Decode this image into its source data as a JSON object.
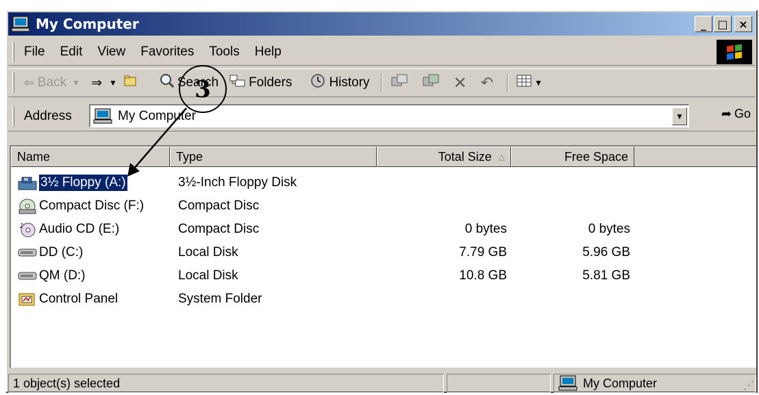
{
  "window": {
    "title": "My Computer",
    "controls": {
      "minimize": "_",
      "maximize": "□",
      "close": "×"
    }
  },
  "menubar": {
    "items": [
      "File",
      "Edit",
      "View",
      "Favorites",
      "Tools",
      "Help"
    ]
  },
  "toolbar": {
    "back": "Back",
    "search": "Search",
    "folders": "Folders",
    "history": "History"
  },
  "addressbar": {
    "label": "Address",
    "value": "My Computer",
    "go": "Go"
  },
  "listview": {
    "columns": [
      "Name",
      "Type",
      "Total Size",
      "Free Space"
    ],
    "rows": [
      {
        "name": "3½ Floppy (A:)",
        "type": "3½-Inch Floppy Disk",
        "total": "",
        "free": "",
        "icon": "floppy-drive-icon",
        "selected": true
      },
      {
        "name": "Compact Disc (F:)",
        "type": "Compact Disc",
        "total": "",
        "free": "",
        "icon": "cd-drive-icon"
      },
      {
        "name": "Audio CD (E:)",
        "type": "Compact Disc",
        "total": "0 bytes",
        "free": "0 bytes",
        "icon": "audio-cd-icon"
      },
      {
        "name": "DD (C:)",
        "type": "Local Disk",
        "total": "7.79 GB",
        "free": "5.96 GB",
        "icon": "hard-disk-icon"
      },
      {
        "name": "QM (D:)",
        "type": "Local Disk",
        "total": "10.8 GB",
        "free": "5.81 GB",
        "icon": "hard-disk-icon"
      },
      {
        "name": "Control Panel",
        "type": "System Folder",
        "total": "",
        "free": "",
        "icon": "control-panel-icon"
      }
    ]
  },
  "statusbar": {
    "selection": "1 object(s) selected",
    "location": "My Computer"
  },
  "annotation": {
    "step": "3"
  },
  "colors": {
    "titlebar_start": "#0a246a",
    "titlebar_end": "#a6caf0",
    "selection": "#0a246a",
    "chrome": "#d4d0c8"
  }
}
